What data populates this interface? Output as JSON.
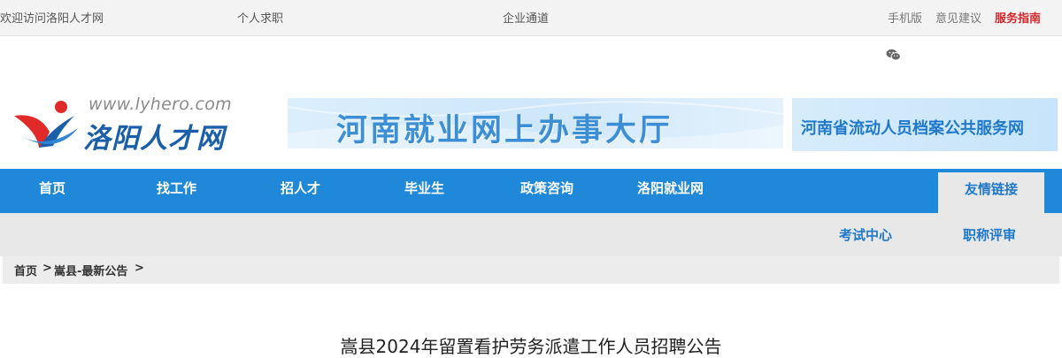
{
  "topbar": {
    "welcome": "欢迎访问洛阳人才网",
    "personal": "个人求职",
    "enterprise": "企业通道",
    "mobile": "手机版",
    "feedback": "意见建议",
    "service": "服务指南"
  },
  "logo": {
    "url": "www.lyhero.com",
    "name": "洛阳人才网"
  },
  "banners": {
    "henan_employment": "河南就业网上办事大厅",
    "archive_service": "河南省流动人员档案公共服务网"
  },
  "nav": {
    "items": [
      "首页",
      "找工作",
      "招人才",
      "毕业生",
      "政策咨询",
      "洛阳就业网"
    ],
    "active": "友情链接"
  },
  "subnav": {
    "items": [
      "考试中心",
      "职称评审"
    ]
  },
  "breadcrumb": {
    "home": "首页",
    "sep1": ">",
    "section": "嵩县-最新公告",
    "sep2": ">"
  },
  "article": {
    "title": "嵩县2024年留置看护劳务派遣工作人员招聘公告"
  },
  "colors": {
    "nav_blue": "#1f88d8",
    "link_blue": "#1f78c8",
    "logo_red": "#e02a2a",
    "service_red": "#d4262b"
  }
}
